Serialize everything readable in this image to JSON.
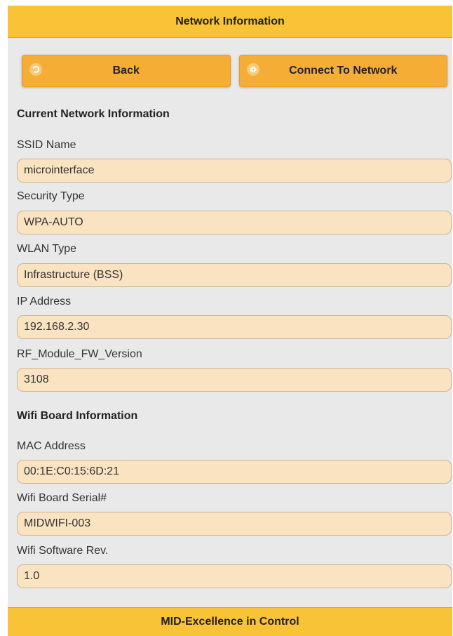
{
  "header": {
    "title": "Network Information"
  },
  "toolbar": {
    "back_label": "Back",
    "back_icon": "back-arrow-icon",
    "connect_label": "Connect To Network",
    "connect_icon": "gear-icon"
  },
  "current_network": {
    "title": "Current Network Information",
    "fields": [
      {
        "label": "SSID Name",
        "value": "microinterface"
      },
      {
        "label": "Security Type",
        "value": "WPA-AUTO"
      },
      {
        "label": "WLAN Type",
        "value": "Infrastructure (BSS)"
      },
      {
        "label": "IP Address",
        "value": "192.168.2.30"
      },
      {
        "label": "RF_Module_FW_Version",
        "value": "3108"
      }
    ]
  },
  "wifi_board": {
    "title": "Wifi Board Information",
    "fields": [
      {
        "label": "MAC Address",
        "value": "00:1E:C0:15:6D:21"
      },
      {
        "label": "Wifi Board Serial#",
        "value": "MIDWIFI-003"
      },
      {
        "label": "Wifi Software Rev.",
        "value": "1.0"
      }
    ]
  },
  "footer": {
    "text": "MID-Excellence in Control"
  },
  "colors": {
    "header_bg": "#f9c338",
    "button_bg": "#f5ad35",
    "field_bg": "#fae3c1",
    "page_bg": "#e9e9e9"
  }
}
